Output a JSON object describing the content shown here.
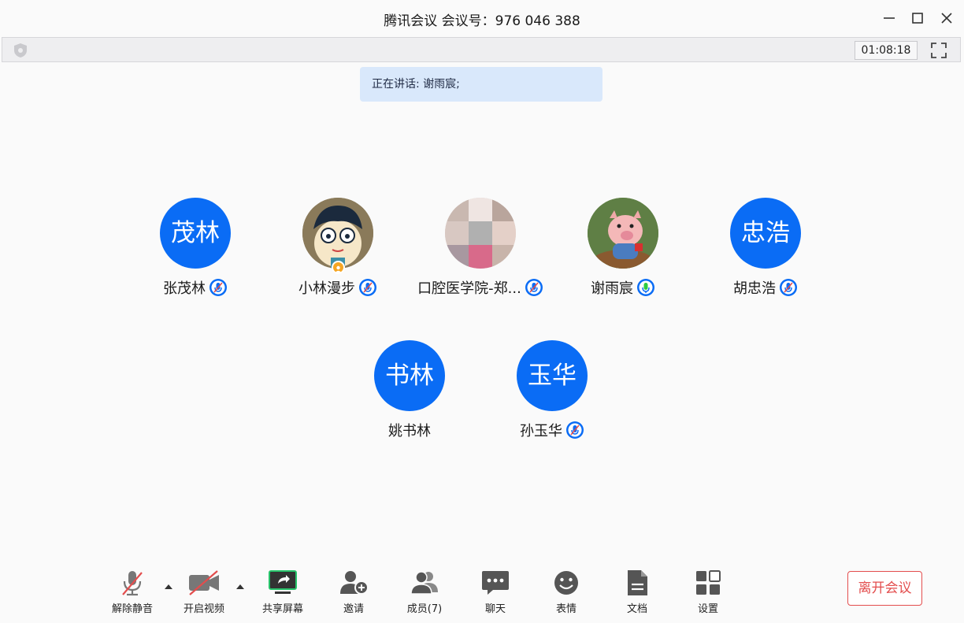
{
  "window": {
    "title": "腾讯会议 会议号：976 046 388"
  },
  "infobar": {
    "timer": "01:08:18"
  },
  "speaking": {
    "text": "正在讲话: 谢雨宸;"
  },
  "participants": [
    {
      "name": "张茂林",
      "initials": "茂林",
      "mic": "muted"
    },
    {
      "name": "小林漫步",
      "initials": "",
      "mic": "muted",
      "host": true
    },
    {
      "name": "口腔医学院-郑...",
      "initials": "",
      "mic": "muted"
    },
    {
      "name": "谢雨宸",
      "initials": "",
      "mic": "active"
    },
    {
      "name": "胡忠浩",
      "initials": "忠浩",
      "mic": "muted"
    },
    {
      "name": "姚书林",
      "initials": "书林",
      "mic": "none"
    },
    {
      "name": "孙玉华",
      "initials": "玉华",
      "mic": "muted"
    }
  ],
  "toolbar": {
    "unmute": "解除静音",
    "video": "开启视频",
    "share": "共享屏幕",
    "invite": "邀请",
    "members": "成员(7)",
    "chat": "聊天",
    "emoji": "表情",
    "docs": "文档",
    "settings": "设置",
    "leave": "离开会议"
  },
  "colors": {
    "accent": "#0a6cf5",
    "danger": "#e34d4d",
    "mic_active": "#2ecc40",
    "share_green": "#27c36a"
  }
}
